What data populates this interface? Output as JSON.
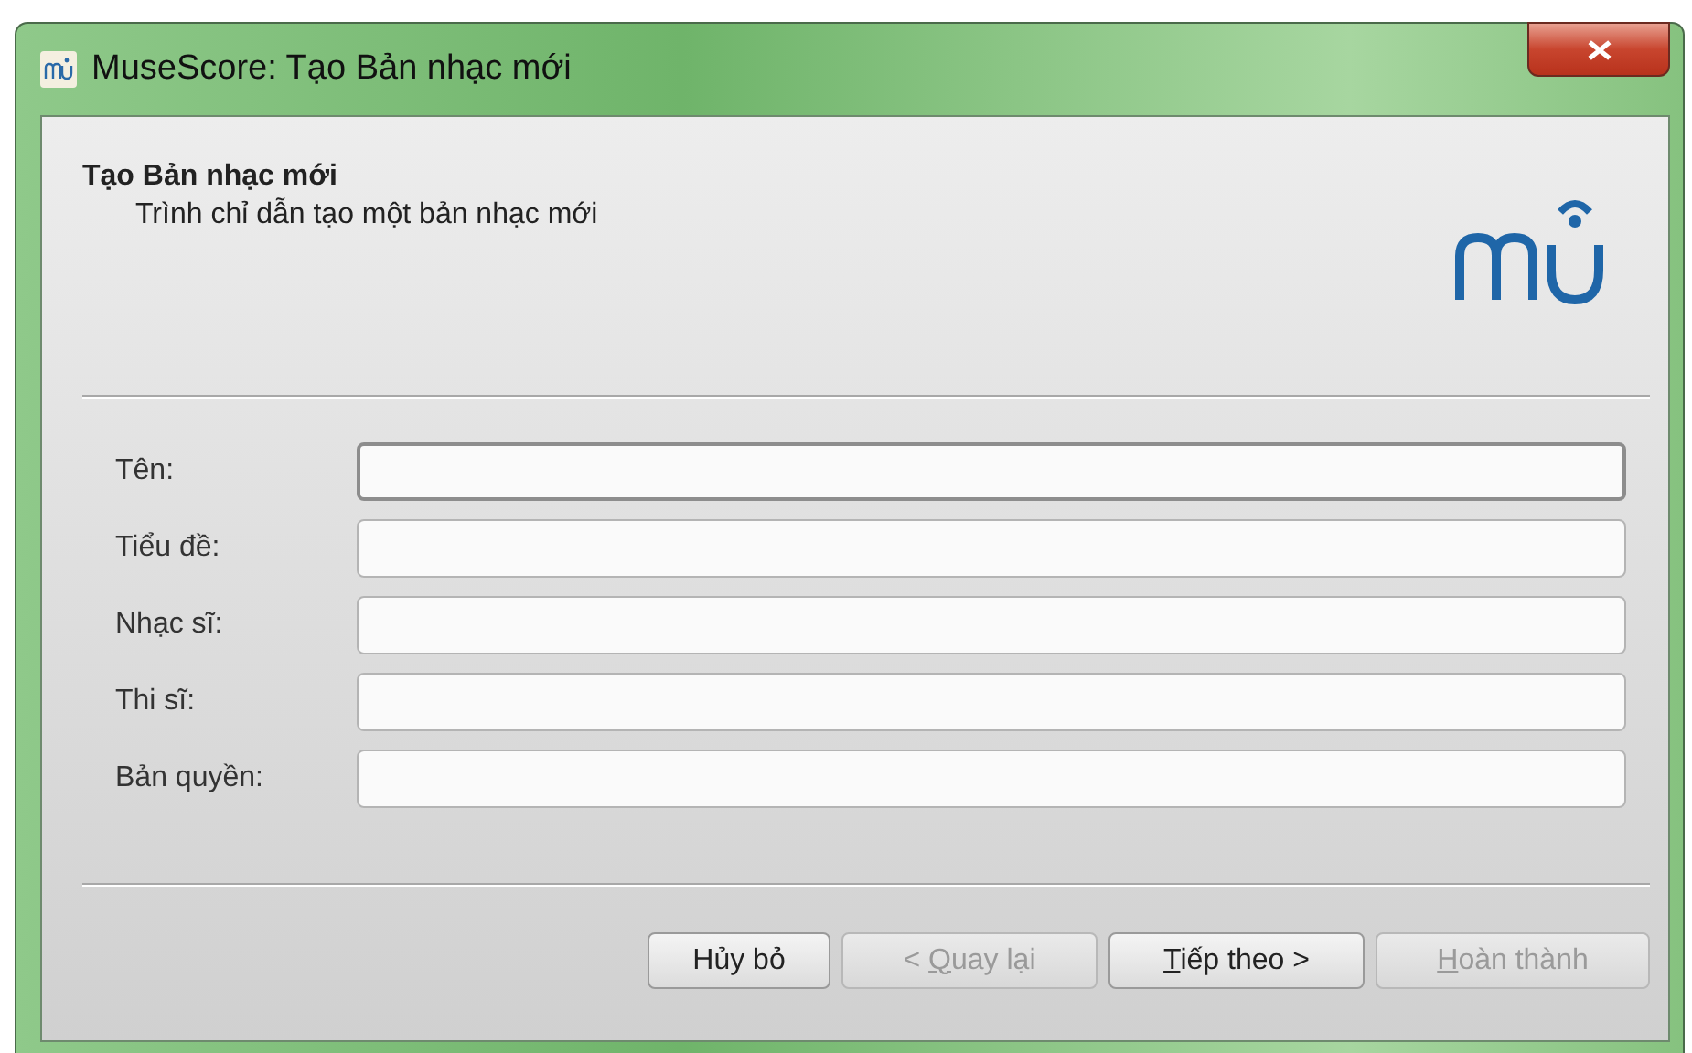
{
  "window": {
    "title": "MuseScore: Tạo Bản nhạc mới"
  },
  "header": {
    "title": "Tạo Bản nhạc mới",
    "subtitle": "Trình chỉ dẫn tạo một bản nhạc mới"
  },
  "fields": [
    {
      "label": "Tên:",
      "focused": true
    },
    {
      "label": "Tiểu đề:",
      "focused": false
    },
    {
      "label": "Nhạc sĩ:",
      "focused": false
    },
    {
      "label": "Thi sĩ:",
      "focused": false
    },
    {
      "label": "Bản quyền:",
      "focused": false
    }
  ],
  "buttons": [
    {
      "label": "Hủy bỏ",
      "disabled": false
    },
    {
      "label_before": "< ",
      "mnemonic": "Q",
      "label_after": "uay lại",
      "disabled": true
    },
    {
      "mnemonic": "T",
      "label_after": "iếp theo >",
      "disabled": false
    },
    {
      "mnemonic": "H",
      "label_after": "oàn thành",
      "disabled": true
    }
  ]
}
